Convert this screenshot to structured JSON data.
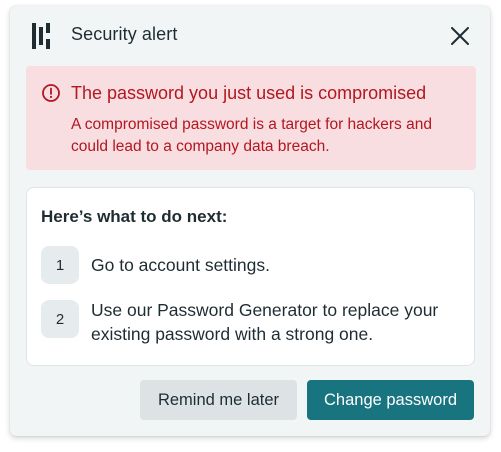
{
  "header": {
    "title": "Security alert",
    "logo_icon": "brand-logo-icon",
    "close_icon": "close-icon"
  },
  "alert": {
    "icon": "alert-circle-icon",
    "title": "The password you just used is compromised",
    "body": "A compromised password is a target for hackers and could lead to a company data breach."
  },
  "steps": {
    "heading": "Here’s what to do next:",
    "items": [
      {
        "number": "1",
        "text": "Go to account settings."
      },
      {
        "number": "2",
        "text": "Use our Password Generator to replace your existing password with a strong one."
      }
    ]
  },
  "actions": {
    "secondary_label": "Remind me later",
    "primary_label": "Change password"
  },
  "colors": {
    "panel_background": "#f2f5f5",
    "alert_background": "#f8dde1",
    "alert_text": "#b3171f",
    "primary_button": "#18747e",
    "secondary_button": "#dde3e5",
    "text": "#1f2d33"
  }
}
